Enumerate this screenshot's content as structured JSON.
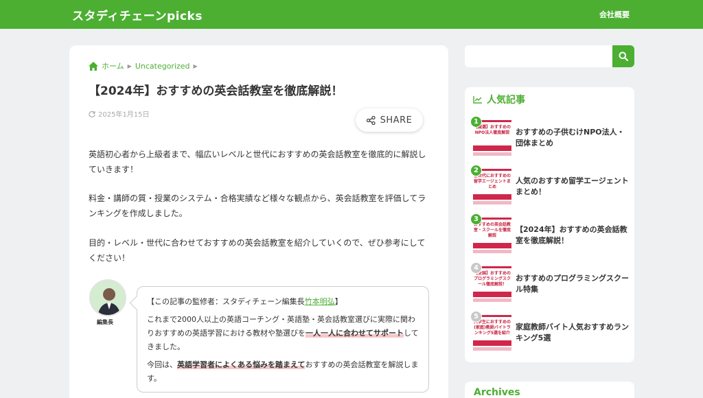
{
  "header": {
    "site_title": "スタディチェーンpicks",
    "nav_company": "会社概要"
  },
  "breadcrumb": {
    "home": "ホーム",
    "category": "Uncategorized"
  },
  "post": {
    "title": "【2024年】おすすめの英会話教室を徹底解説！",
    "date": "2025年1月15日",
    "share_label": "SHARE",
    "paragraphs": [
      "英語初心者から上級者まで、幅広いレベルと世代におすすめの英会話教室を徹底的に解説していきます！",
      "料金・講師の質・授業のシステム・合格実績など様々な観点から、英会話教室を評価してランキングを作成しました。",
      "目的・レベル・世代に合わせておすすめの英会話教室を紹介していくので、ぜひ参考にしてください！"
    ]
  },
  "supervisor": {
    "caption": "編集長",
    "heading_prefix": "【この記事の監修者：スタディチェーン編集長",
    "name": "竹本明弘",
    "heading_suffix": "】",
    "body_part1": "これまで2000人以上の英語コーチング・英語塾・英会話教室選びに実際に関わりおすすめの英語学習における教材や塾選びを",
    "body_highlight": "一人一人に合わせてサポート",
    "body_part2": "してきました。",
    "line2_prefix": "今回は、",
    "line2_highlight": "英語学習者によくある悩みを踏まえて",
    "line2_suffix": "おすすめの英会話教室を解説します。"
  },
  "sidebar": {
    "search_placeholder": "",
    "popular_title": "人気記事",
    "popular": [
      {
        "rank": "1",
        "title": "おすすめの子供むけNPO法人・団体まとめ",
        "thumb": "【厳選】おすすめのNPO法人徹底解説"
      },
      {
        "rank": "2",
        "title": "人気のおすすめ留学エージェントまとめ！",
        "thumb": "全世代におすすめの留学エージェントまとめ"
      },
      {
        "rank": "3",
        "title": "【2024年】おすすめの英会話教室を徹底解説！",
        "thumb": "おすすめの英会話教室・スクールを徹底解説"
      },
      {
        "rank": "4",
        "title": "おすすめのプログラミングスクール特集",
        "thumb": "【全国】おすすめのプログラミングスクール徹底解説！"
      },
      {
        "rank": "5",
        "title": "家庭教師バイト人気おすすめランキング5選",
        "thumb": "大学生におすすめの(家庭)教師バイトランキング5選を紹介"
      }
    ],
    "archives_title": "Archives"
  },
  "colors": {
    "brand_green": "#4caf32",
    "background": "#eef0f2",
    "highlight_pink": "#f7c6c6",
    "thumb_red": "#d0264a"
  }
}
